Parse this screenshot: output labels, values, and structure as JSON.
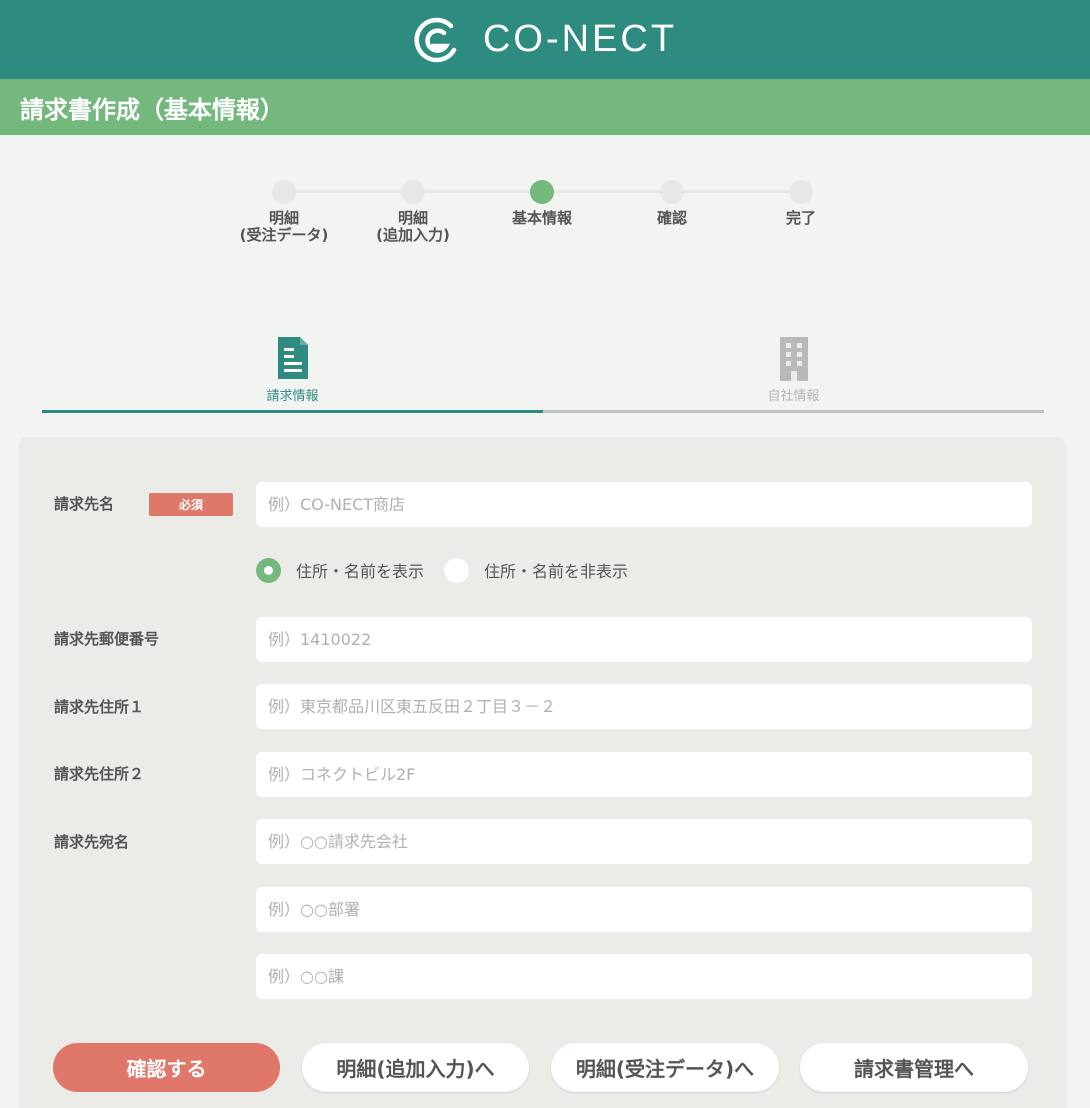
{
  "header": {
    "brand": "CO-NECT",
    "page_title": "請求書作成（基本情報）"
  },
  "stepper": {
    "steps": [
      {
        "label": "明細\n(受注データ)"
      },
      {
        "label": "明細\n(追加入力)"
      },
      {
        "label": "基本情報"
      },
      {
        "label": "確認"
      },
      {
        "label": "完了"
      }
    ],
    "active_index": 2
  },
  "tabs": {
    "invoice_info": {
      "label": "請求情報",
      "icon": "document-icon"
    },
    "company_info": {
      "label": "自社情報",
      "icon": "building-icon"
    }
  },
  "form": {
    "recipient_name": {
      "label": "請求先名",
      "required_badge": "必須",
      "placeholder": "例）CO-NECT商店"
    },
    "display_options": {
      "show": "住所・名前を表示",
      "hide": "住所・名前を非表示",
      "selected": "show"
    },
    "postal_code": {
      "label": "請求先郵便番号",
      "placeholder": "例）1410022"
    },
    "address1": {
      "label": "請求先住所１",
      "placeholder": "例）東京都品川区東五反田２丁目３－２"
    },
    "address2": {
      "label": "請求先住所２",
      "placeholder": "例）コネクトビル2F"
    },
    "addressee": {
      "label": "請求先宛名",
      "placeholder_company": "例）○○請求先会社",
      "placeholder_department": "例）○○部署",
      "placeholder_section": "例）○○課"
    }
  },
  "buttons": {
    "confirm": "確認する",
    "to_additional": "明細(追加入力)へ",
    "to_order_data": "明細(受注データ)へ",
    "to_invoice_mgmt": "請求書管理へ"
  },
  "colors": {
    "header": "#2e8b80",
    "title_bar": "#74b87e",
    "accent": "#e0776b",
    "step_active": "#74b87e"
  }
}
